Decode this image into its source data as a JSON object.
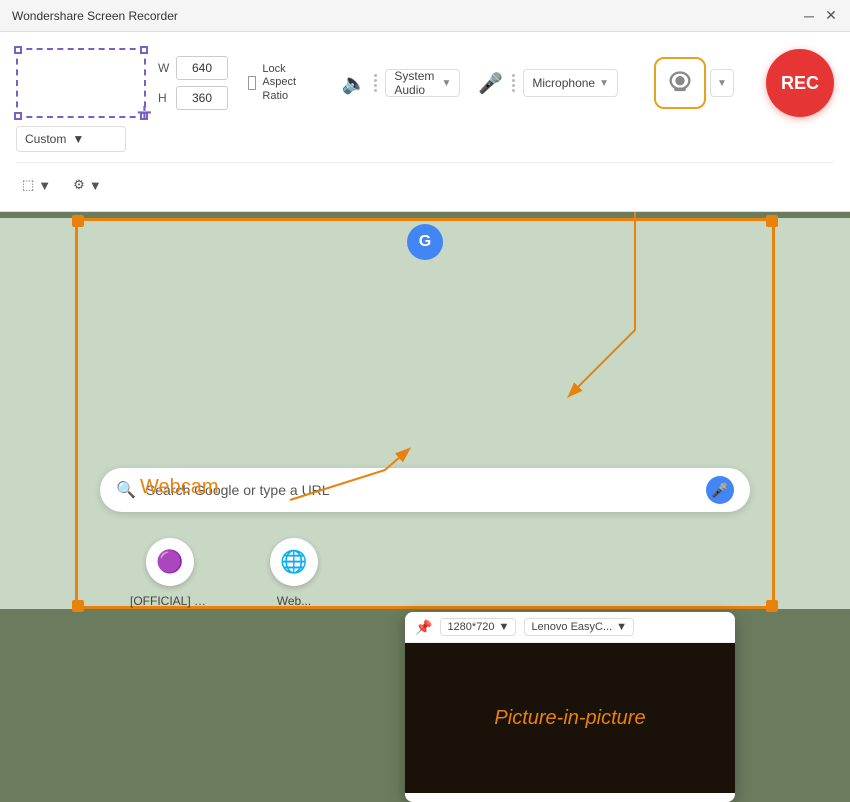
{
  "titlebar": {
    "title": "Wondershare Screen Recorder",
    "minimize_label": "─",
    "close_label": "✕"
  },
  "recorder": {
    "width_label": "W",
    "height_label": "H",
    "width_value": "640",
    "height_value": "360",
    "lock_aspect_label": "Lock Aspect Ratio",
    "preset_label": "Custom",
    "system_audio_label": "System Audio",
    "microphone_label": "Microphone",
    "webcam_label": "Webcam",
    "rec_label": "REC"
  },
  "pip": {
    "resolution_label": "1280*720",
    "camera_label": "Lenovo EasyC...",
    "pip_label": "Picture-in-picture"
  },
  "browser": {
    "search_placeholder": "Search Google or type a URL"
  },
  "shortcuts": [
    {
      "label": "[OFFICIAL] W...",
      "icon": "🟣"
    },
    {
      "label": "Web...",
      "icon": "🌐"
    }
  ],
  "annotations": {
    "webcam_text": "Webcam",
    "arrow_color": "#e8820a"
  }
}
